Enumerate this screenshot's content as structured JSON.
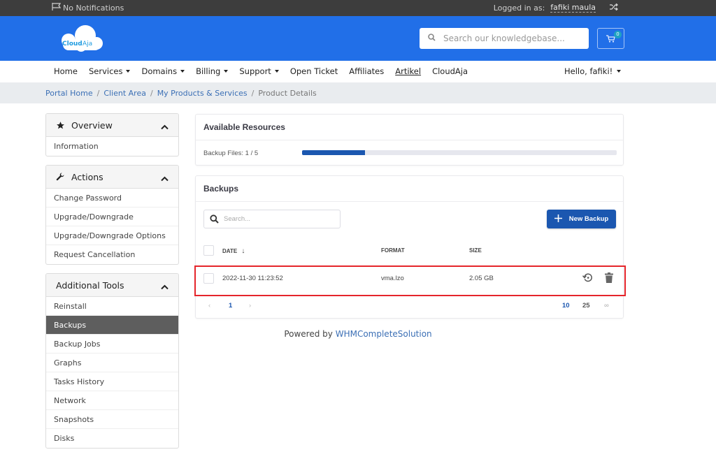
{
  "topbar": {
    "notifications": "No Notifications",
    "logged_in_label": "Logged in as:",
    "user_name": "fafiki maula"
  },
  "header": {
    "logo_text_bold": "Cloud",
    "logo_text_light": "Aja",
    "search_placeholder": "Search our knowledgebase...",
    "cart_count": "0"
  },
  "nav": {
    "items": [
      {
        "label": "Home",
        "dropdown": false
      },
      {
        "label": "Services",
        "dropdown": true
      },
      {
        "label": "Domains",
        "dropdown": true
      },
      {
        "label": "Billing",
        "dropdown": true
      },
      {
        "label": "Support",
        "dropdown": true
      },
      {
        "label": "Open Ticket",
        "dropdown": false
      },
      {
        "label": "Affiliates",
        "dropdown": false
      },
      {
        "label": "Artikel",
        "dropdown": false
      },
      {
        "label": "CloudAja",
        "dropdown": false
      }
    ],
    "greeting": "Hello, fafiki!"
  },
  "breadcrumb": {
    "items": [
      "Portal Home",
      "Client Area",
      "My Products & Services"
    ],
    "active": "Product Details"
  },
  "sidebar": {
    "overview": {
      "title": "Overview",
      "items": [
        "Information"
      ]
    },
    "actions": {
      "title": "Actions",
      "items": [
        "Change Password",
        "Upgrade/Downgrade",
        "Upgrade/Downgrade Options",
        "Request Cancellation"
      ]
    },
    "tools": {
      "title": "Additional Tools",
      "items": [
        "Reinstall",
        "Backups",
        "Backup Jobs",
        "Graphs",
        "Tasks History",
        "Network",
        "Snapshots",
        "Disks"
      ],
      "active": "Backups"
    }
  },
  "resources": {
    "title": "Available Resources",
    "label": "Backup Files: 1 / 5",
    "used": 1,
    "total": 5,
    "fill_color": "#1b57b0"
  },
  "backups": {
    "title": "Backups",
    "search_placeholder": "Search...",
    "new_button": "New Backup",
    "columns": {
      "date": "DATE",
      "format": "FORMAT",
      "size": "SIZE"
    },
    "sort_indicator": "↓",
    "rows": [
      {
        "date": "2022-11-30 11:23:52",
        "format": "vma.lzo",
        "size": "2.05 GB"
      }
    ],
    "pagination": {
      "current_page": "1",
      "page_sizes": [
        "10",
        "25",
        "∞"
      ],
      "active_size": "10"
    }
  },
  "footer": {
    "prefix": "Powered by",
    "link": "WHMCompleteSolution"
  },
  "colors": {
    "header_bg": "#216fe8",
    "topbar_bg": "#3d3d3d",
    "primary": "#1b57b0",
    "highlight": "#e5252b",
    "link": "#3b6fb5"
  }
}
